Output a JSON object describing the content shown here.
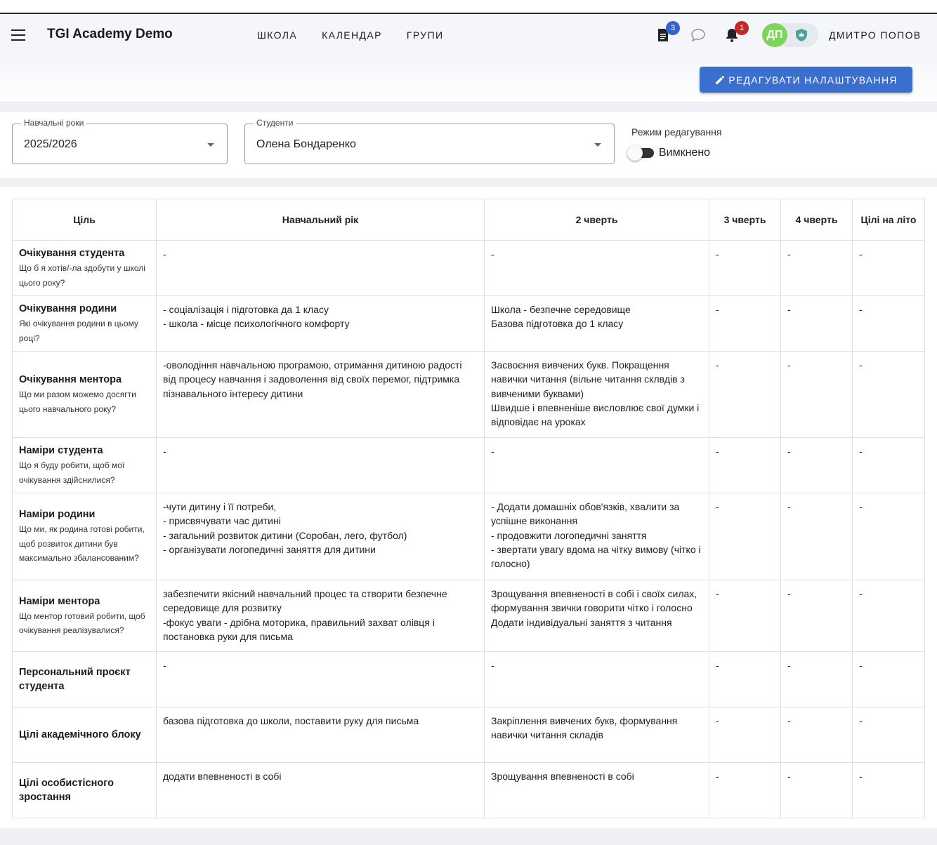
{
  "app": {
    "title": "TGI Academy Demo",
    "nav": [
      "ШКОЛА",
      "КАЛЕНДАР",
      "ГРУПИ"
    ],
    "badges": {
      "documents": "3",
      "notifications": "1"
    },
    "user": {
      "initials": "ДП",
      "name": "ДМИТРО ПОПОВ"
    }
  },
  "settings": {
    "edit_button": "РЕДАГУВАТИ НАЛАШТУВАННЯ"
  },
  "filters": {
    "year": {
      "label": "Навчальні роки",
      "value": "2025/2026"
    },
    "student": {
      "label": "Студенти",
      "value": "Олена Бондаренко"
    },
    "edit_mode": {
      "label": "Режим редагування",
      "state": "Вимкнено"
    }
  },
  "colors": {
    "accent": "#3a6fd0",
    "avatar": "#7cd55a",
    "badge_blue": "#3563c9",
    "badge_red": "#c62828"
  },
  "table": {
    "headers": [
      "Ціль",
      "Навчальний рік",
      "2 чверть",
      "3 чверть",
      "4 чверть",
      "Цілі на літо"
    ],
    "rows": [
      {
        "title": "Очікування студента",
        "subtitle": "Що б я хотів/-ла здобути у школі цього року?",
        "cells": [
          "-",
          "-",
          "-",
          "-",
          "-"
        ]
      },
      {
        "title": "Очікування родини",
        "subtitle": "Які очікування родини в цьому році?",
        "cells": [
          "- соціалізація і підготовка да 1 класу\n- школа - місце психологічного комфорту",
          "Школа - безпечне середовище\nБазова підготовка до 1 класу",
          "-",
          "-",
          "-"
        ]
      },
      {
        "title": "Очікування ментора",
        "subtitle": "Що ми разом можемо досягти цього навчального року?",
        "cells": [
          "-оволодіння навчальною програмою, отримання дитиною радості від процесу навчання і задоволення від своїх перемог, підтримка пізнавального інтересу дитини",
          "Засвоєння вивчених букв. Покращення навички читання (вільне читання склвдів з вивченими буквами)\nШвидше і впевненіше висловлює свої думки і відповідає на уроках",
          "-",
          "-",
          "-"
        ]
      },
      {
        "title": "Наміри студента",
        "subtitle": "Що я буду робити, щоб мої очікування здійснилися?",
        "cells": [
          "-",
          "-",
          "-",
          "-",
          "-"
        ]
      },
      {
        "title": "Наміри родини",
        "subtitle": "Що ми, як родина готові робити, щоб розвиток дитини був максимально збалансованим?",
        "cells": [
          "-чути дитину і її потреби,\n- присвячувати час дитині\n- загальний розвиток дитини (Соробан, лего, футбол)\n- організувати логопедичні заняття для дитини",
          "- Додати домашніх обов'язків, хвалити за успішне виконання\n- продовжити логопедичні заняття\n- звертати увагу вдома на чітку вимову (чітко і голосно)",
          "-",
          "-",
          "-"
        ]
      },
      {
        "title": "Наміри ментора",
        "subtitle": "Що ментор готовий робити, щоб очікування реалізувалися?",
        "cells": [
          "забезпечити якісний навчальний процес та створити безпечне середовище для розвитку\n-фокус уваги - дрібна моторика, правильний захват олівця і постановка руки для письма",
          "Зрощування впевненості в собі і своїх силах, формування звички говорити чітко і голосно\nДодати індивідуальні заняття з читання",
          "-",
          "-",
          "-"
        ]
      },
      {
        "title": "Персональний проєкт студента",
        "subtitle": "",
        "cells": [
          "-",
          "-",
          "-",
          "-",
          "-"
        ]
      },
      {
        "title": "Цілі академічного блоку",
        "subtitle": "",
        "cells": [
          "базова підготовка до школи, поставити руку для письма",
          "Закріплення вивчених букв, формування навички читання складів",
          "-",
          "-",
          "-"
        ]
      },
      {
        "title": "Цілі особистісного зростання",
        "subtitle": "",
        "cells": [
          "додати впевненості в собі",
          "Зрощування впевненості в собі",
          "-",
          "-",
          "-"
        ]
      }
    ]
  }
}
